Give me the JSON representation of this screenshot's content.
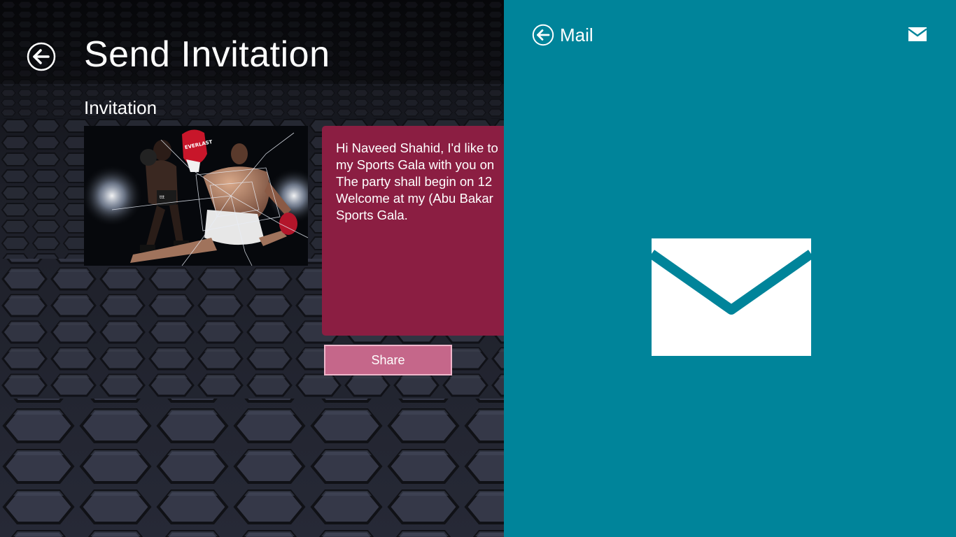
{
  "app": {
    "title": "Send Invitation",
    "section_title": "Invitation",
    "image_label": "EVERLAST",
    "message_lines": [
      "Hi Naveed Shahid, I'd like to",
      "my Sports Gala with you on",
      "The party shall begin on 12",
      "Welcome at my (Abu Bakar",
      "Sports Gala."
    ],
    "share_label": "Share",
    "colors": {
      "message_box": "#8b1e42",
      "share_button": "#c5678a",
      "background": "#15171d"
    }
  },
  "share_pane": {
    "title": "Mail",
    "icons": [
      "back-arrow-icon",
      "mail-icon"
    ],
    "colors": {
      "background": "#00849a",
      "tile": "#ffffff"
    }
  }
}
